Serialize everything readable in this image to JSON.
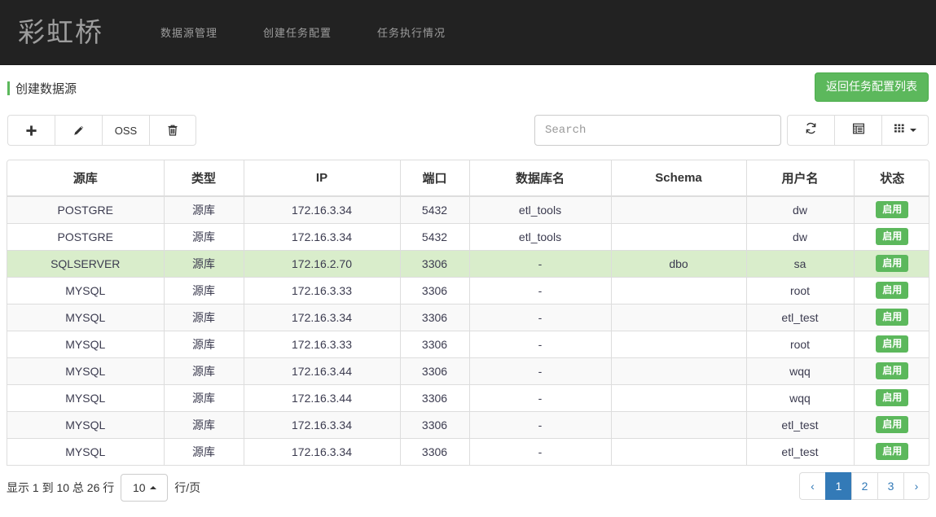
{
  "navbar": {
    "brand": "彩虹桥",
    "links": [
      {
        "label": "数据源管理"
      },
      {
        "label": "创建任务配置"
      },
      {
        "label": "任务执行情况"
      }
    ]
  },
  "page": {
    "title": "创建数据源",
    "return_button": "返回任务配置列表",
    "accent_color": "#5cb85c"
  },
  "toolbar": {
    "buttons": [
      {
        "name": "add",
        "icon": "plus-icon",
        "label": ""
      },
      {
        "name": "edit",
        "icon": "pencil-icon",
        "label": ""
      },
      {
        "name": "oss",
        "icon": "",
        "label": "OSS"
      },
      {
        "name": "delete",
        "icon": "trash-icon",
        "label": ""
      }
    ],
    "search": {
      "value": "",
      "placeholder": "Search"
    },
    "icons": [
      {
        "name": "refresh",
        "icon": "refresh-icon"
      },
      {
        "name": "toggle",
        "icon": "list-view-icon"
      },
      {
        "name": "columns",
        "icon": "columns-grid-icon"
      }
    ]
  },
  "table": {
    "columns": [
      "源库",
      "类型",
      "IP",
      "端口",
      "数据库名",
      "Schema",
      "用户名",
      "状态"
    ],
    "rows": [
      {
        "source": "POSTGRE",
        "type": "源库",
        "ip": "172.16.3.34",
        "port": "5432",
        "dbname": "etl_tools",
        "schema": "",
        "user": "dw",
        "status": "启用",
        "selected": false
      },
      {
        "source": "POSTGRE",
        "type": "源库",
        "ip": "172.16.3.34",
        "port": "5432",
        "dbname": "etl_tools",
        "schema": "",
        "user": "dw",
        "status": "启用",
        "selected": false
      },
      {
        "source": "SQLSERVER",
        "type": "源库",
        "ip": "172.16.2.70",
        "port": "3306",
        "dbname": "-",
        "schema": "dbo",
        "user": "sa",
        "status": "启用",
        "selected": true
      },
      {
        "source": "MYSQL",
        "type": "源库",
        "ip": "172.16.3.33",
        "port": "3306",
        "dbname": "-",
        "schema": "",
        "user": "root",
        "status": "启用",
        "selected": false
      },
      {
        "source": "MYSQL",
        "type": "源库",
        "ip": "172.16.3.34",
        "port": "3306",
        "dbname": "-",
        "schema": "",
        "user": "etl_test",
        "status": "启用",
        "selected": false
      },
      {
        "source": "MYSQL",
        "type": "源库",
        "ip": "172.16.3.33",
        "port": "3306",
        "dbname": "-",
        "schema": "",
        "user": "root",
        "status": "启用",
        "selected": false
      },
      {
        "source": "MYSQL",
        "type": "源库",
        "ip": "172.16.3.44",
        "port": "3306",
        "dbname": "-",
        "schema": "",
        "user": "wqq",
        "status": "启用",
        "selected": false
      },
      {
        "source": "MYSQL",
        "type": "源库",
        "ip": "172.16.3.44",
        "port": "3306",
        "dbname": "-",
        "schema": "",
        "user": "wqq",
        "status": "启用",
        "selected": false
      },
      {
        "source": "MYSQL",
        "type": "源库",
        "ip": "172.16.3.34",
        "port": "3306",
        "dbname": "-",
        "schema": "",
        "user": "etl_test",
        "status": "启用",
        "selected": false
      },
      {
        "source": "MYSQL",
        "type": "源库",
        "ip": "172.16.3.34",
        "port": "3306",
        "dbname": "-",
        "schema": "",
        "user": "etl_test",
        "status": "启用",
        "selected": false
      }
    ]
  },
  "footer": {
    "summary": "显示 1 到 10 总 26 行",
    "page_size": "10",
    "page_size_suffix": "行/页",
    "pagination": [
      {
        "label": "‹",
        "active": false
      },
      {
        "label": "1",
        "active": true
      },
      {
        "label": "2",
        "active": false
      },
      {
        "label": "3",
        "active": false
      },
      {
        "label": "›",
        "active": false
      }
    ]
  }
}
